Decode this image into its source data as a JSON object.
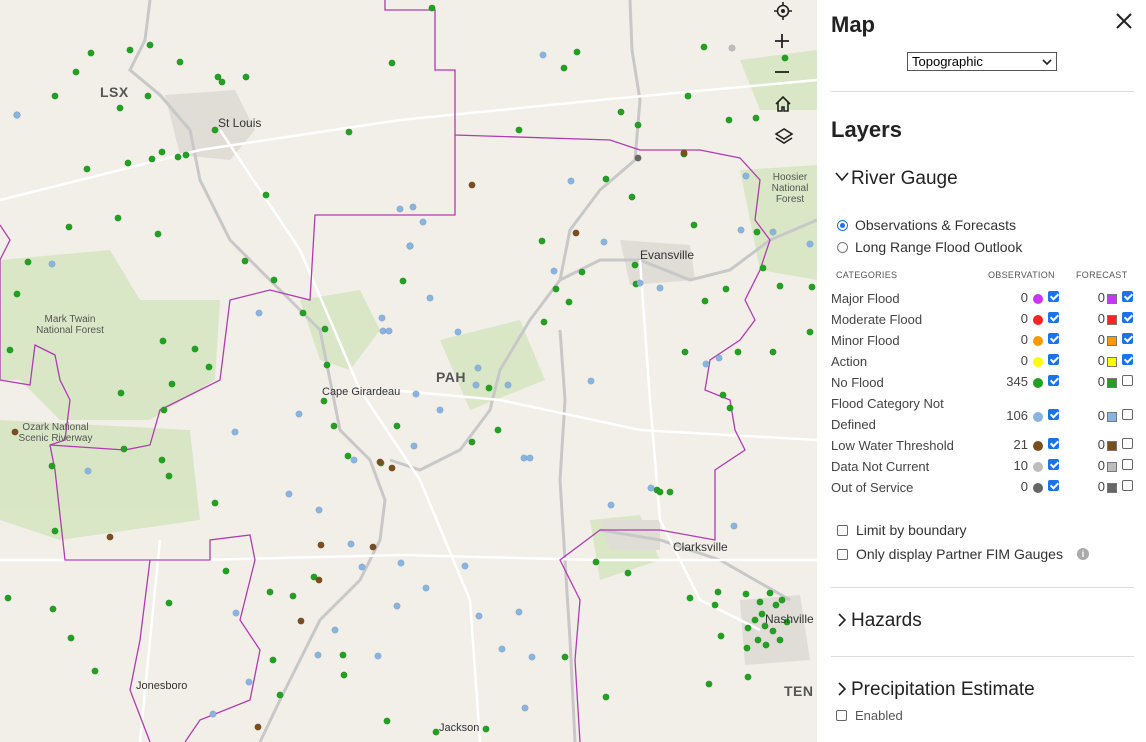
{
  "panel": {
    "title": "Map",
    "basemap_selected": "Topographic",
    "layers_title": "Layers",
    "river_gauge": {
      "title": "River Gauge",
      "modes": [
        {
          "label": "Observations & Forecasts",
          "selected": true
        },
        {
          "label": "Long Range Flood Outlook",
          "selected": false
        }
      ],
      "headers": {
        "categories": "CATEGORIES",
        "observation": "OBSERVATION",
        "forecast": "FORECAST"
      },
      "categories": [
        {
          "label": "Major Flood",
          "obs_count": "0",
          "obs_color": "#cc33ff",
          "obs_checked": true,
          "fc_count": "0",
          "fc_color": "#cc33ff",
          "fc_checked": true
        },
        {
          "label": "Moderate Flood",
          "obs_count": "0",
          "obs_color": "#ff2222",
          "obs_checked": true,
          "fc_count": "0",
          "fc_color": "#ff2222",
          "fc_checked": true
        },
        {
          "label": "Minor Flood",
          "obs_count": "0",
          "obs_color": "#ff9900",
          "obs_checked": true,
          "fc_count": "0",
          "fc_color": "#ff9900",
          "fc_checked": true
        },
        {
          "label": "Action",
          "obs_count": "0",
          "obs_color": "#ffff00",
          "obs_checked": true,
          "fc_count": "0",
          "fc_color": "#ffff00",
          "fc_checked": true
        },
        {
          "label": "No Flood",
          "obs_count": "345",
          "obs_color": "#22a022",
          "obs_checked": true,
          "fc_count": "0",
          "fc_color": "#22a022",
          "fc_checked": false
        },
        {
          "label": "Flood Category Not Defined",
          "obs_count": "106",
          "obs_color": "#88b4e0",
          "obs_checked": true,
          "fc_count": "0",
          "fc_color": "#88b4e0",
          "fc_checked": false
        },
        {
          "label": "Low Water Threshold",
          "obs_count": "21",
          "obs_color": "#7a4e1e",
          "obs_checked": true,
          "fc_count": "0",
          "fc_color": "#7a4e1e",
          "fc_checked": false
        },
        {
          "label": "Data Not Current",
          "obs_count": "10",
          "obs_color": "#bdbdbd",
          "obs_checked": true,
          "fc_count": "0",
          "fc_color": "#bdbdbd",
          "fc_checked": false
        },
        {
          "label": "Out of Service",
          "obs_count": "0",
          "obs_color": "#666666",
          "obs_checked": true,
          "fc_count": "0",
          "fc_color": "#666666",
          "fc_checked": false
        }
      ],
      "options": [
        {
          "label": "Limit by boundary",
          "checked": false
        },
        {
          "label": "Only display Partner FIM Gauges",
          "checked": false
        }
      ]
    },
    "hazards_title": "Hazards",
    "precip_title": "Precipitation Estimate",
    "precip_enabled_label": "Enabled"
  },
  "map": {
    "places": [
      "St Louis",
      "Evansville",
      "Cape Girardeau",
      "Clarksville",
      "Nashville",
      "Jonesboro",
      "Jackson",
      "Mark Twain National Forest",
      "Ozark National Scenic Riverway",
      "Hoosier National Forest"
    ],
    "offices": [
      "LSX",
      "PAH",
      "TEN"
    ]
  }
}
